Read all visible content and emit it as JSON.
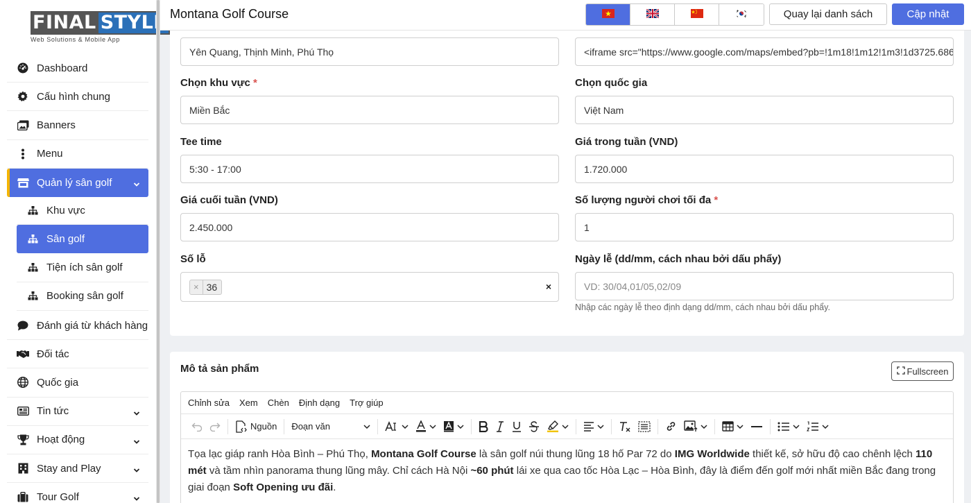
{
  "logo": {
    "word1": "FINAL",
    "word2": "STYLE",
    "tagline": "Web Solutions & Mobile App"
  },
  "sidebar": {
    "items": [
      {
        "label": "Dashboard",
        "icon": "dashboard-gauge-icon"
      },
      {
        "label": "Cấu hình chung",
        "icon": "gear-icon"
      },
      {
        "label": "Banners",
        "icon": "images-icon"
      },
      {
        "label": "Menu",
        "icon": "vertical-dots-icon"
      },
      {
        "label": "Quản lý sân golf",
        "icon": "store-icon",
        "expanded": true
      },
      {
        "label": "Đánh giá từ khách hàng",
        "icon": "comment-icon"
      },
      {
        "label": "Đối tác",
        "icon": "handshake-icon"
      },
      {
        "label": "Quốc gia",
        "icon": "globe-icon"
      },
      {
        "label": "Tin tức",
        "icon": "newspaper-icon"
      },
      {
        "label": "Hoạt động",
        "icon": "trophy-icon"
      },
      {
        "label": "Stay and Play",
        "icon": "building-icon"
      },
      {
        "label": "Tour Golf",
        "icon": "suitcase-icon"
      }
    ],
    "sub_items": [
      {
        "label": "Khu vực"
      },
      {
        "label": "Sân golf",
        "selected": true
      },
      {
        "label": "Tiện ích sân golf"
      },
      {
        "label": "Booking sân golf"
      }
    ]
  },
  "header": {
    "title": "Montana Golf Course",
    "languages": [
      "vietnam-flag-icon",
      "uk-flag-icon",
      "china-flag-icon",
      "korea-flag-icon"
    ],
    "back_label": "Quay lại danh sách",
    "update_label": "Cập nhật"
  },
  "form": {
    "address_value": "Yên Quang, Thịnh Minh, Phú Thọ",
    "map_value": "<iframe src=\"https://www.google.com/maps/embed?pb=!1m18!1m12!1m3!1d3725.686",
    "region": {
      "label": "Chọn khu vực",
      "required": "*",
      "value": "Miền Bắc"
    },
    "country": {
      "label": "Chọn quốc gia",
      "value": "Việt Nam"
    },
    "tee_time": {
      "label": "Tee time",
      "value": "5:30 - 17:00"
    },
    "weekday_price": {
      "label": "Giá trong tuần (VND)",
      "value": "1.720.000"
    },
    "weekend_price": {
      "label": "Giá cuối tuần (VND)",
      "value": "2.450.000"
    },
    "max_players": {
      "label": "Số lượng người chơi tối đa",
      "required": "*",
      "value": "1"
    },
    "holes": {
      "label": "Số lỗ",
      "tag": "36",
      "tag_remove": "×",
      "clear": "×"
    },
    "holidays": {
      "label": "Ngày lễ (dd/mm, cách nhau bởi dấu phẩy)",
      "placeholder": "VD: 30/04,01/05,02/09",
      "hint": "Nhập các ngày lễ theo định dạng dd/mm, cách nhau bởi dấu phẩy."
    }
  },
  "editor": {
    "section_title": "Mô tả sản phẩm",
    "fullscreen_label": "Fullscreen",
    "menus": [
      "Chỉnh sửa",
      "Xem",
      "Chèn",
      "Định dạng",
      "Trợ giúp"
    ],
    "source_label": "Nguồn",
    "block_format": "Đoạn văn",
    "content": {
      "t1": "Tọa lạc giáp ranh Hòa Bình – Phú Thọ, ",
      "b1": "Montana Golf Course",
      "t2": " là sân golf núi thung lũng 18 hố Par 72 do ",
      "b2": "IMG Worldwide",
      "t3": " thiết kế, sở hữu độ cao chênh lệch ",
      "b3": "110 mét",
      "t4": " và tầm nhìn panorama thung lũng mây. Chỉ cách Hà Nội ",
      "b4": "~60 phút",
      "t5": " lái xe qua cao tốc Hòa Lạc – Hòa Bình, đây là điểm đến golf mới nhất miền Bắc đang trong giai đoạn ",
      "b5": "Soft Opening ưu đãi",
      "t6": "."
    }
  }
}
